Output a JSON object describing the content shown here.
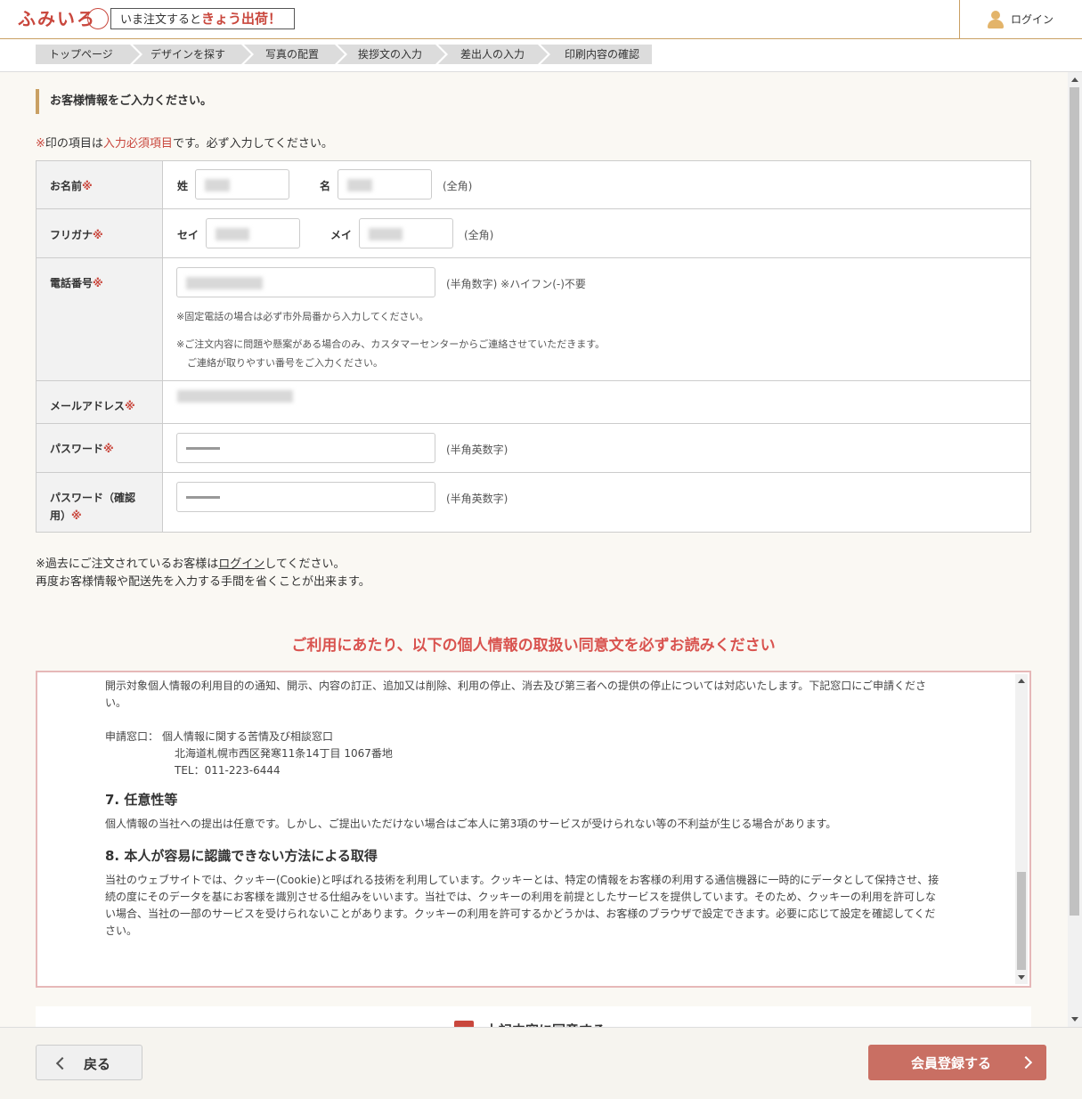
{
  "header": {
    "logo_text": "ふみいろ",
    "tagline_prefix": "いま注文すると",
    "tagline_highlight": "きょう出荷！",
    "login_label": "ログイン"
  },
  "breadcrumb": [
    "トップページ",
    "デザインを探す",
    "写真の配置",
    "挨拶文の入力",
    "差出人の入力",
    "印刷内容の確認"
  ],
  "section_title": "お客様情報をご入力ください。",
  "required_note": {
    "mark": "※",
    "prefix": "印の項目は",
    "required": "入力必須項目",
    "suffix": "です。必ず入力してください。"
  },
  "form": {
    "name": {
      "label": "お名前",
      "req": "※",
      "sei_label": "姓",
      "mei_label": "名",
      "hint": "(全角)"
    },
    "kana": {
      "label": "フリガナ",
      "req": "※",
      "sei_label": "セイ",
      "mei_label": "メイ",
      "hint": "(全角)"
    },
    "phone": {
      "label": "電話番号",
      "req": "※",
      "hint": "(半角数字) ※ハイフン(-)不要",
      "note1": "※固定電話の場合は必ず市外局番から入力してください。",
      "note2": "※ご注文内容に問題や懸案がある場合のみ、カスタマーセンターからご連絡させていただきます。",
      "note3": "ご連絡が取りやすい番号をご入力ください。"
    },
    "email": {
      "label": "メールアドレス",
      "req": "※"
    },
    "password": {
      "label": "パスワード",
      "req": "※",
      "hint": "(半角英数字)"
    },
    "password_confirm": {
      "label_line1": "パスワード（確認",
      "label_line2": "用）",
      "req": "※",
      "hint": "(半角英数字)"
    }
  },
  "past_note": {
    "prefix": "※過去にご注文されているお客様は",
    "link": "ログイン",
    "suffix": "してください。",
    "line2": "再度お客様情報や配送先を入力する手間を省くことが出来ます。"
  },
  "consent_title": "ご利用にあたり、以下の個人情報の取扱い同意文を必ずお読みください",
  "terms": {
    "p1": "開示対象個人情報の利用目的の通知、開示、内容の訂正、追加又は削除、利用の停止、消去及び第三者への提供の停止については対応いたします。下記窓口にご申請ください。",
    "window_label": "申請窓口：",
    "window_name": "個人情報に関する苦情及び相談窓口",
    "address": "北海道札幌市西区発寒11条14丁目 1067番地",
    "tel": "TEL：011-223-6444",
    "h7": "7. 任意性等",
    "p7": "個人情報の当社への提出は任意です。しかし、ご提出いただけない場合はご本人に第3項のサービスが受けられない等の不利益が生じる場合があります。",
    "h8": "8. 本人が容易に認識できない方法による取得",
    "p8": "当社のウェブサイトでは、クッキー(Cookie)と呼ばれる技術を利用しています。クッキーとは、特定の情報をお客様の利用する通信機器に一時的にデータとして保持させ、接続の度にそのデータを基にお客様を識別させる仕組みをいいます。当社では、クッキーの利用を前提としたサービスを提供しています。そのため、クッキーの利用を許可しない場合、当社の一部のサービスを受けられないことがあります。クッキーの利用を許可するかどうかは、お客様のブラウザで設定できます。必要に応じて設定を確認してください。"
  },
  "agree_label": "上記内容に同意する",
  "footer": {
    "back_label": "戻る",
    "register_label": "会員登録する"
  }
}
